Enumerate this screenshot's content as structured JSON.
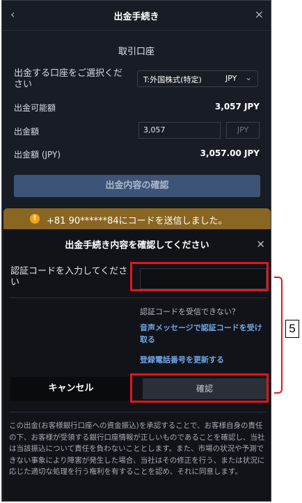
{
  "header": {
    "title": "出金手続き",
    "back_icon": "‹",
    "close_icon": "×"
  },
  "account_section": {
    "title": "取引口座",
    "select_label": "出金する口座をご選択ください",
    "selected_account": "T:外国株式(特定)",
    "selected_currency": "JPY",
    "chevron_icon": "⌄",
    "available_label": "出金可能額",
    "available_value": "3,057 JPY",
    "amount_label": "出金額",
    "amount_value": "3,057",
    "amount_currency": "JPY",
    "amount_jpy_label": "出金額 (JPY)",
    "amount_jpy_value": "3,057.00 JPY",
    "confirm_button": "出金内容の確認"
  },
  "toast": {
    "icon": "!",
    "message": "+81 90******84にコードを送信しました。"
  },
  "modal": {
    "title": "出金手続き内容を確認してください",
    "close_icon": "×",
    "code_label": "認証コードを入力してください",
    "code_value": "",
    "no_code_text": "認証コードを受信できない？",
    "voice_link": "音声メッセージで認証コードを受け取る",
    "update_phone_link": "登録電話番号を更新する",
    "cancel_button": "キャンセル",
    "confirm_button": "確認",
    "disclaimer": "この出金(お客様銀行口座への資金振込)を承認することで、お客様自身の責任の下、お客様が受領する銀行口座情報が正しいものであることを確認し、当社は当該振込について責任を負わないこととします。また、市場の状況や予測できない事象により障害が発生した場合、当社はその修正を行う、または状況に応じた適切な処理を行う権利を有することを認め、それに同意します。"
  },
  "annotation": {
    "callout_number": "5",
    "highlight_color": "#e3161b"
  },
  "colors": {
    "panel_bg": "#181c24",
    "modal_bg": "#111318",
    "toast_bg": "#8a6623",
    "link": "#6fa6e6",
    "primary_button": "#3d5478"
  }
}
